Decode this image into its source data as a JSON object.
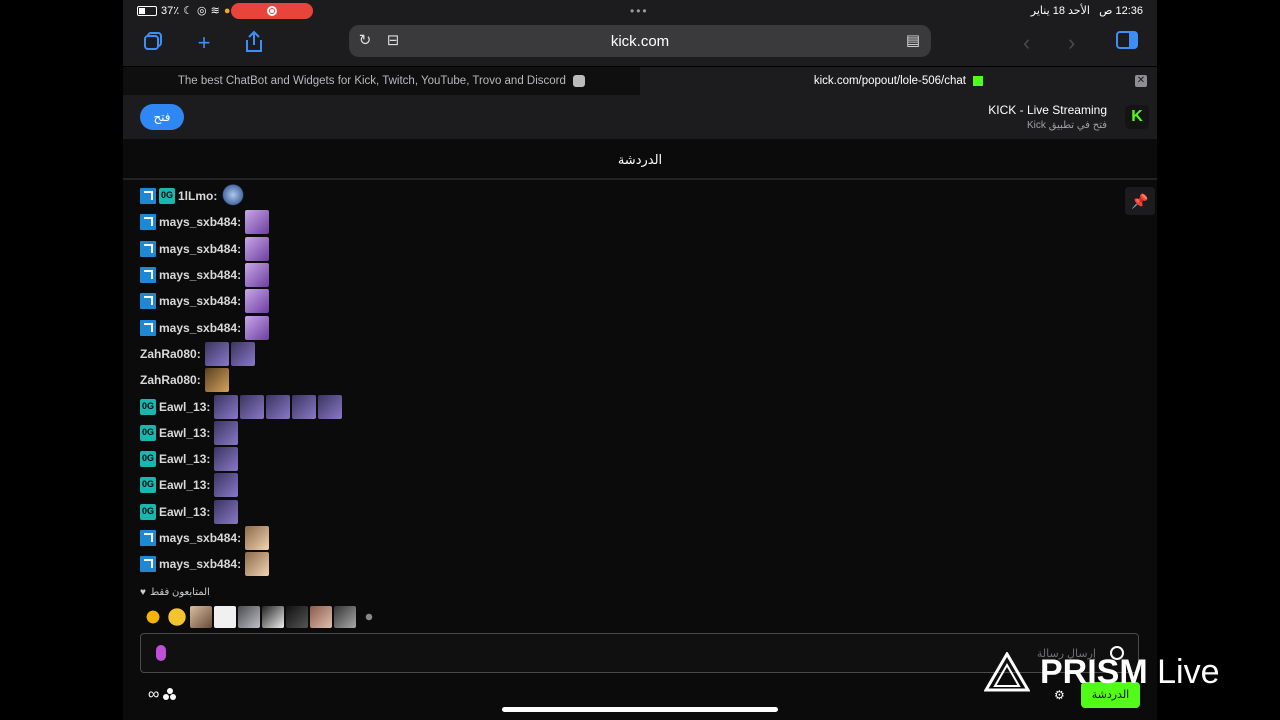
{
  "status": {
    "time": "12:36",
    "ampm": "ص",
    "date": "الأحد 18 يناير",
    "battery": "37٪"
  },
  "browser": {
    "url": "kick.com",
    "tabs": [
      {
        "title": "The best ChatBot and Widgets for Kick, Twitch, YouTube, Trovo and Discord",
        "active": false
      },
      {
        "title": "kick.com/popout/lole-506/chat",
        "active": true
      }
    ]
  },
  "banner": {
    "open_label": "فتح",
    "title": "KICK - Live Streaming",
    "subtitle": "فتح في تطبيق Kick"
  },
  "chat": {
    "header": "الدردشة",
    "messages": [
      {
        "username": "1lLmo",
        "color": "#d9d9d9",
        "badges": [
          "mod",
          "og"
        ],
        "emotes": [
          "char"
        ]
      },
      {
        "username": "mays_sxb484",
        "color": "#d9d9d9",
        "badges": [
          "mod"
        ],
        "emotes": [
          "lilac"
        ]
      },
      {
        "username": "mays_sxb484",
        "color": "#d9d9d9",
        "badges": [
          "mod"
        ],
        "emotes": [
          "lilac"
        ]
      },
      {
        "username": "mays_sxb484",
        "color": "#d9d9d9",
        "badges": [
          "mod"
        ],
        "emotes": [
          "lilac"
        ]
      },
      {
        "username": "mays_sxb484",
        "color": "#d9d9d9",
        "badges": [
          "mod"
        ],
        "emotes": [
          "lilac"
        ]
      },
      {
        "username": "mays_sxb484",
        "color": "#d9d9d9",
        "badges": [
          "mod"
        ],
        "emotes": [
          "lilac"
        ]
      },
      {
        "username": "ZahRa080",
        "color": "#d9d9d9",
        "badges": [],
        "emotes": [
          "purple",
          "purple"
        ]
      },
      {
        "username": "ZahRa080",
        "color": "#d9d9d9",
        "badges": [],
        "emotes": [
          "gold"
        ]
      },
      {
        "username": "Eawl_13",
        "color": "#d9d9d9",
        "badges": [
          "og"
        ],
        "emotes": [
          "purple",
          "purple",
          "purple",
          "purple",
          "purple"
        ]
      },
      {
        "username": "Eawl_13",
        "color": "#d9d9d9",
        "badges": [
          "og"
        ],
        "emotes": [
          "purple"
        ]
      },
      {
        "username": "Eawl_13",
        "color": "#d9d9d9",
        "badges": [
          "og"
        ],
        "emotes": [
          "purple"
        ]
      },
      {
        "username": "Eawl_13",
        "color": "#d9d9d9",
        "badges": [
          "og"
        ],
        "emotes": [
          "purple"
        ]
      },
      {
        "username": "Eawl_13",
        "color": "#d9d9d9",
        "badges": [
          "og"
        ],
        "emotes": [
          "purple"
        ]
      },
      {
        "username": "mays_sxb484",
        "color": "#d9d9d9",
        "badges": [
          "mod"
        ],
        "emotes": [
          "peach"
        ]
      },
      {
        "username": "mays_sxb484",
        "color": "#d9d9d9",
        "badges": [
          "mod"
        ],
        "emotes": [
          "peach"
        ]
      }
    ],
    "followers_only": "المتابعون فقط",
    "input_placeholder": "إرسال رسالة",
    "send_label": "الدردشة"
  },
  "watermark": {
    "brand": "PRISM",
    "suffix": " Live"
  },
  "colors": {
    "accent_blue": "#2f87f3",
    "kick_green": "#53fc18",
    "mod_badge": "#1e88d4",
    "og_badge": "#18b7b0"
  }
}
